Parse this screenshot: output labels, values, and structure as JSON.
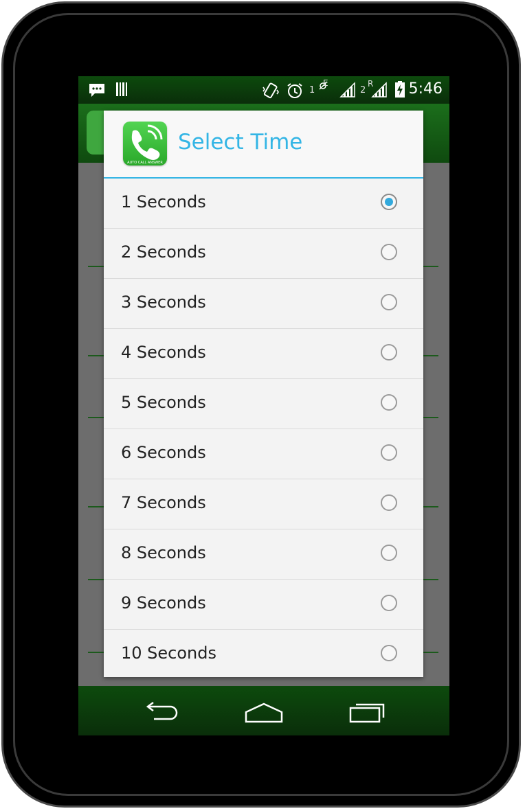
{
  "status_bar": {
    "time": "5:46",
    "sim1": "1",
    "sim2": "2",
    "network_e": "E",
    "network_r": "R",
    "icons": [
      "message-icon",
      "barcode-icon",
      "vibrate-icon",
      "alarm-icon",
      "signal-icon",
      "battery-charging-icon"
    ]
  },
  "dialog": {
    "title": "Select Time",
    "app_icon": "auto-call-answer-icon",
    "app_icon_caption": "AUTO CALL ANSWER",
    "selected_index": 0,
    "options": [
      {
        "label": "1 Seconds",
        "checked": true
      },
      {
        "label": "2 Seconds",
        "checked": false
      },
      {
        "label": "3 Seconds",
        "checked": false
      },
      {
        "label": "4 Seconds",
        "checked": false
      },
      {
        "label": "5 Seconds",
        "checked": false
      },
      {
        "label": "6 Seconds",
        "checked": false
      },
      {
        "label": "7 Seconds",
        "checked": false
      },
      {
        "label": "8 Seconds",
        "checked": false
      },
      {
        "label": "9 Seconds",
        "checked": false
      },
      {
        "label": "10 Seconds",
        "checked": false
      }
    ]
  },
  "nav_bar": {
    "icons": [
      "back-icon",
      "home-icon",
      "recent-apps-icon"
    ]
  },
  "colors": {
    "accent": "#33b5e5",
    "bar_green": "#0d4a0d",
    "dialog_bg": "#f3f3f3",
    "radio_checked": "#33a9dc"
  }
}
